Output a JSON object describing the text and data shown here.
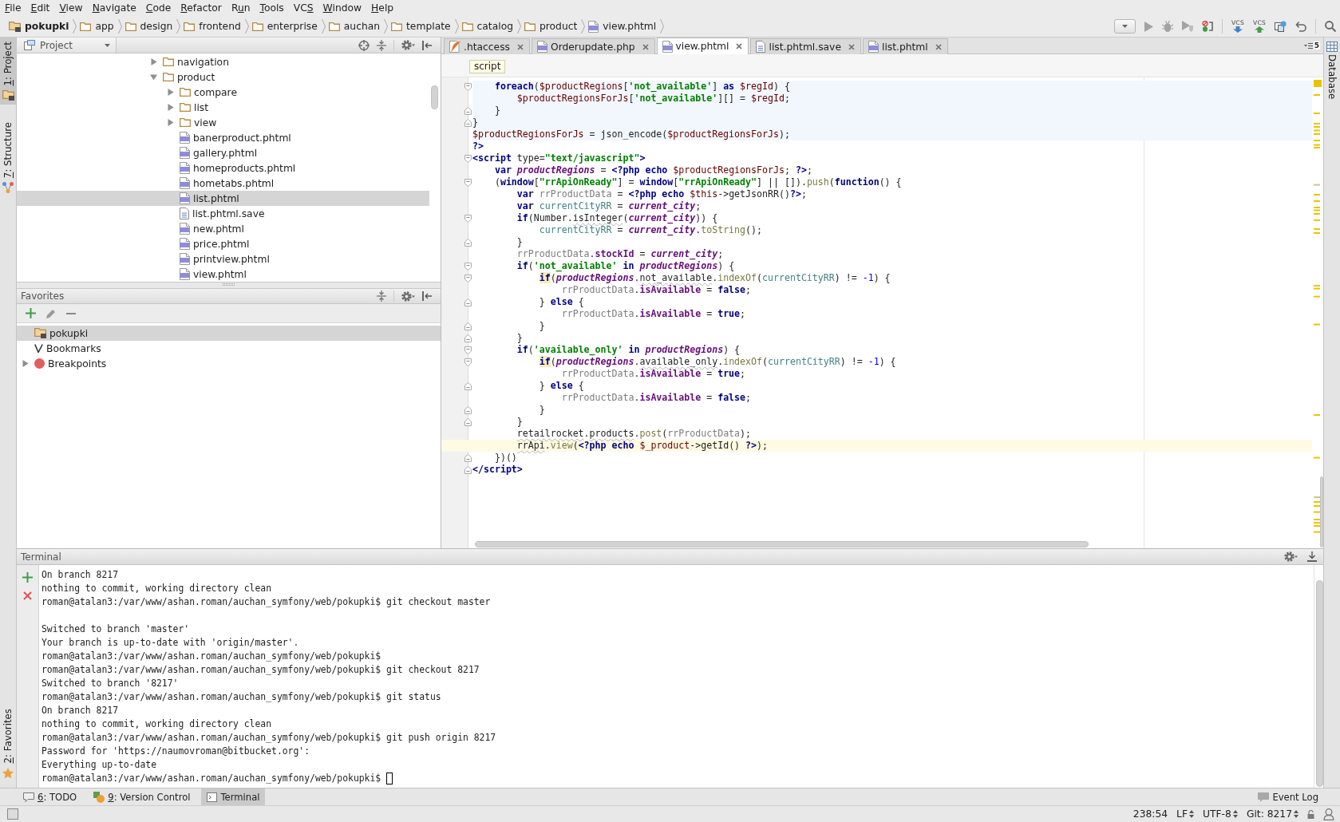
{
  "menu_bar": [
    {
      "label_parts": [
        {
          "text": "F",
          "underline": true
        },
        {
          "text": "ile",
          "underline": false
        }
      ]
    },
    {
      "label_parts": [
        {
          "text": "E",
          "underline": true
        },
        {
          "text": "dit",
          "underline": false
        }
      ]
    },
    {
      "label_parts": [
        {
          "text": "V",
          "underline": true
        },
        {
          "text": "iew",
          "underline": false
        }
      ]
    },
    {
      "label_parts": [
        {
          "text": "N",
          "underline": true
        },
        {
          "text": "avigate",
          "underline": false
        }
      ]
    },
    {
      "label_parts": [
        {
          "text": "C",
          "underline": true
        },
        {
          "text": "ode",
          "underline": false
        }
      ]
    },
    {
      "label_parts": [
        {
          "text": "R",
          "underline": true
        },
        {
          "text": "efactor",
          "underline": false
        }
      ]
    },
    {
      "label_parts": [
        {
          "text": "R",
          "underline": false
        },
        {
          "text": "u",
          "underline": true
        },
        {
          "text": "n",
          "underline": false
        }
      ]
    },
    {
      "label_parts": [
        {
          "text": "T",
          "underline": true
        },
        {
          "text": "ools",
          "underline": false
        }
      ]
    },
    {
      "label_parts": [
        {
          "text": "VC",
          "underline": false
        },
        {
          "text": "S",
          "underline": true
        }
      ]
    },
    {
      "label_parts": [
        {
          "text": "W",
          "underline": true
        },
        {
          "text": "indow",
          "underline": false
        }
      ]
    },
    {
      "label_parts": [
        {
          "text": "H",
          "underline": true
        },
        {
          "text": "elp",
          "underline": false
        }
      ]
    }
  ],
  "navigation_bar": {
    "breadcrumbs": [
      {
        "label": "pokupki",
        "kind": "project"
      },
      {
        "label": "app",
        "kind": "folder"
      },
      {
        "label": "design",
        "kind": "folder"
      },
      {
        "label": "frontend",
        "kind": "folder"
      },
      {
        "label": "enterprise",
        "kind": "folder"
      },
      {
        "label": "auchan",
        "kind": "folder"
      },
      {
        "label": "template",
        "kind": "folder"
      },
      {
        "label": "catalog",
        "kind": "folder"
      },
      {
        "label": "product",
        "kind": "folder"
      },
      {
        "label": "view.phtml",
        "kind": "php-file"
      }
    ],
    "vcs_buttons": [
      {
        "label": "VCS",
        "kind": "update"
      },
      {
        "label": "VCS",
        "kind": "commit"
      }
    ]
  },
  "left_tool_stripe": {
    "top": [
      {
        "label_parts": [
          {
            "text": "1",
            "underline": true
          },
          {
            "text": ": Project",
            "underline": false
          }
        ],
        "kind": "project",
        "selected": true
      },
      {
        "label_parts": [
          {
            "text": "7",
            "underline": true
          },
          {
            "text": ": Structure",
            "underline": false
          }
        ],
        "kind": "structure",
        "selected": false
      }
    ],
    "bottom": [
      {
        "label_parts": [
          {
            "text": "2",
            "underline": true
          },
          {
            "text": ": Favorites",
            "underline": false
          }
        ],
        "kind": "favorites",
        "selected": false
      }
    ]
  },
  "project_panel": {
    "view": "Project",
    "tree": [
      {
        "label": "navigation",
        "kind": "folder",
        "expanded": false,
        "selected": false
      },
      {
        "label": "product",
        "kind": "folder",
        "expanded": true,
        "selected": false,
        "children": [
          {
            "label": "compare",
            "kind": "folder",
            "expanded": false,
            "selected": false
          },
          {
            "label": "list",
            "kind": "folder",
            "expanded": false,
            "selected": false
          },
          {
            "label": "view",
            "kind": "folder",
            "expanded": false,
            "selected": false
          },
          {
            "label": "banerproduct.phtml",
            "kind": "php-file",
            "selected": false
          },
          {
            "label": "gallery.phtml",
            "kind": "php-file",
            "selected": false
          },
          {
            "label": "homeproducts.phtml",
            "kind": "php-file",
            "selected": false
          },
          {
            "label": "hometabs.phtml",
            "kind": "php-file",
            "selected": false
          },
          {
            "label": "list.phtml",
            "kind": "php-file",
            "selected": true
          },
          {
            "label": "list.phtml.save",
            "kind": "text-file",
            "selected": false
          },
          {
            "label": "new.phtml",
            "kind": "php-file",
            "selected": false
          },
          {
            "label": "price.phtml",
            "kind": "php-file",
            "selected": false
          },
          {
            "label": "printview.phtml",
            "kind": "php-file",
            "selected": false
          },
          {
            "label": "view.phtml",
            "kind": "php-file",
            "selected": false
          }
        ]
      }
    ]
  },
  "favorites_panel": {
    "title": "Favorites",
    "items": [
      {
        "label": "pokupki",
        "kind": "project",
        "selected": true
      },
      {
        "label": "Bookmarks",
        "kind": "bookmarks",
        "selected": false
      },
      {
        "label": "Breakpoints",
        "kind": "breakpoints",
        "expanded": false,
        "selected": false
      }
    ]
  },
  "editor": {
    "tabs": [
      {
        "label": ".htaccess",
        "kind": "htaccess",
        "selected": false
      },
      {
        "label": "Orderupdate.php",
        "kind": "php-file",
        "selected": false
      },
      {
        "label": "view.phtml",
        "kind": "php-file",
        "selected": true
      },
      {
        "label": "list.phtml.save",
        "kind": "text-file",
        "selected": false
      },
      {
        "label": "list.phtml",
        "kind": "php-file",
        "selected": false
      }
    ],
    "hidden_tab_count": "5",
    "breadcrumb": "script",
    "lines": [
      {
        "kind": "php-block",
        "current": false,
        "fold_start": true,
        "fold_end": false,
        "tokens": [
          {
            "text": "    foreach",
            "kind": "keyword"
          },
          {
            "text": "(",
            "kind": "plain"
          },
          {
            "text": "$productRegions",
            "kind": "php-variable"
          },
          {
            "text": "[",
            "kind": "plain"
          },
          {
            "text": "'not_available'",
            "kind": "string"
          },
          {
            "text": "] ",
            "kind": "plain"
          },
          {
            "text": "as ",
            "kind": "keyword"
          },
          {
            "text": "$regId",
            "kind": "php-variable"
          },
          {
            "text": ") {",
            "kind": "plain"
          }
        ]
      },
      {
        "kind": "php-block",
        "current": false,
        "fold_start": false,
        "fold_end": false,
        "tokens": [
          {
            "text": "        $productRegionsForJs",
            "kind": "php-variable"
          },
          {
            "text": "[",
            "kind": "plain"
          },
          {
            "text": "'not_available'",
            "kind": "string"
          },
          {
            "text": "][] = ",
            "kind": "plain"
          },
          {
            "text": "$regId",
            "kind": "php-variable"
          },
          {
            "text": ";",
            "kind": "plain"
          }
        ]
      },
      {
        "kind": "php-block",
        "current": false,
        "fold_start": false,
        "fold_end": true,
        "tokens": [
          {
            "text": "    }",
            "kind": "plain"
          }
        ]
      },
      {
        "kind": "php-block",
        "current": false,
        "fold_start": false,
        "fold_end": true,
        "tokens": [
          {
            "text": "}",
            "kind": "plain"
          }
        ]
      },
      {
        "kind": "php-block",
        "current": false,
        "fold_start": false,
        "fold_end": false,
        "tokens": [
          {
            "text": "$productRegionsForJs",
            "kind": "php-variable"
          },
          {
            "text": " = json_encode(",
            "kind": "plain"
          },
          {
            "text": "$productRegionsForJs",
            "kind": "php-variable"
          },
          {
            "text": ");",
            "kind": "plain"
          }
        ]
      },
      {
        "kind": "template",
        "current": false,
        "fold_start": false,
        "fold_end": false,
        "tokens": [
          {
            "text": "?>",
            "kind": "php-tag"
          }
        ]
      },
      {
        "kind": "template",
        "current": false,
        "fold_start": true,
        "fold_end": false,
        "tokens": [
          {
            "text": "<script",
            "kind": "html-tag"
          },
          {
            "text": " type=",
            "kind": "plain"
          },
          {
            "text": "\"text/javascript\"",
            "kind": "string"
          },
          {
            "text": ">",
            "kind": "html-tag"
          }
        ]
      },
      {
        "kind": "template",
        "current": false,
        "fold_start": false,
        "fold_end": false,
        "tokens": [
          {
            "text": "    var ",
            "kind": "keyword"
          },
          {
            "text": "productRegions",
            "kind": "global-variable"
          },
          {
            "text": " = ",
            "kind": "plain"
          },
          {
            "text": "<?php ",
            "kind": "php-tag"
          },
          {
            "text": "echo ",
            "kind": "keyword"
          },
          {
            "text": "$productRegionsForJs",
            "kind": "php-variable"
          },
          {
            "text": "; ",
            "kind": "plain"
          },
          {
            "text": "?>",
            "kind": "php-tag"
          },
          {
            "text": ";",
            "kind": "plain"
          }
        ]
      },
      {
        "kind": "template",
        "current": false,
        "fold_start": true,
        "fold_end": false,
        "tokens": [
          {
            "text": "    (",
            "kind": "plain"
          },
          {
            "text": "window",
            "kind": "keyword"
          },
          {
            "text": "[",
            "kind": "plain"
          },
          {
            "text": "\"rrApiOnReady\"",
            "kind": "string"
          },
          {
            "text": "] = ",
            "kind": "plain"
          },
          {
            "text": "window",
            "kind": "keyword"
          },
          {
            "text": "[",
            "kind": "plain"
          },
          {
            "text": "\"rrApiOnReady\"",
            "kind": "string"
          },
          {
            "text": "] || []).",
            "kind": "plain"
          },
          {
            "text": "push",
            "kind": "method"
          },
          {
            "text": "(",
            "kind": "plain"
          },
          {
            "text": "function",
            "kind": "keyword"
          },
          {
            "text": "() {",
            "kind": "plain"
          }
        ]
      },
      {
        "kind": "template",
        "current": false,
        "fold_start": false,
        "fold_end": false,
        "tokens": [
          {
            "text": "        var ",
            "kind": "keyword"
          },
          {
            "text": "rrProductData",
            "kind": "implicit-variable"
          },
          {
            "text": " = ",
            "kind": "plain"
          },
          {
            "text": "<?php ",
            "kind": "php-tag"
          },
          {
            "text": "echo ",
            "kind": "keyword"
          },
          {
            "text": "$this",
            "kind": "php-variable"
          },
          {
            "text": "->getJsonRR()",
            "kind": "plain"
          },
          {
            "text": "?>",
            "kind": "php-tag"
          },
          {
            "text": ";",
            "kind": "plain"
          }
        ]
      },
      {
        "kind": "template",
        "current": false,
        "fold_start": false,
        "fold_end": false,
        "tokens": [
          {
            "text": "        var ",
            "kind": "keyword"
          },
          {
            "text": "currentCityRR",
            "kind": "local-variable"
          },
          {
            "text": " = ",
            "kind": "plain"
          },
          {
            "text": "current_city",
            "kind": "global-variable"
          },
          {
            "text": ";",
            "kind": "plain"
          }
        ]
      },
      {
        "kind": "template",
        "current": false,
        "fold_start": true,
        "fold_end": false,
        "tokens": [
          {
            "text": "        if",
            "kind": "keyword"
          },
          {
            "text": "(Number.",
            "kind": "plain"
          },
          {
            "text": "isInteger",
            "kind": "unresolved"
          },
          {
            "text": "(",
            "kind": "plain"
          },
          {
            "text": "current_city",
            "kind": "global-variable"
          },
          {
            "text": ")) {",
            "kind": "plain"
          }
        ]
      },
      {
        "kind": "template",
        "current": false,
        "fold_start": false,
        "fold_end": false,
        "tokens": [
          {
            "text": "            currentCityRR",
            "kind": "local-variable"
          },
          {
            "text": " = ",
            "kind": "plain"
          },
          {
            "text": "current_city",
            "kind": "global-variable"
          },
          {
            "text": ".",
            "kind": "plain"
          },
          {
            "text": "toString",
            "kind": "method"
          },
          {
            "text": "();",
            "kind": "plain"
          }
        ]
      },
      {
        "kind": "template",
        "current": false,
        "fold_start": false,
        "fold_end": true,
        "tokens": [
          {
            "text": "        }",
            "kind": "plain"
          }
        ]
      },
      {
        "kind": "template",
        "current": false,
        "fold_start": false,
        "fold_end": false,
        "tokens": [
          {
            "text": "        rrProductData",
            "kind": "implicit-variable"
          },
          {
            "text": ".",
            "kind": "plain"
          },
          {
            "text": "stockId",
            "kind": "field"
          },
          {
            "text": " = ",
            "kind": "plain"
          },
          {
            "text": "current_city",
            "kind": "global-variable"
          },
          {
            "text": ";",
            "kind": "plain"
          }
        ]
      },
      {
        "kind": "template",
        "current": false,
        "fold_start": true,
        "fold_end": false,
        "tokens": [
          {
            "text": "        if",
            "kind": "keyword"
          },
          {
            "text": "(",
            "kind": "plain"
          },
          {
            "text": "'not_available' ",
            "kind": "string"
          },
          {
            "text": "in ",
            "kind": "keyword"
          },
          {
            "text": "productRegions",
            "kind": "global-variable"
          },
          {
            "text": ") {",
            "kind": "plain"
          }
        ]
      },
      {
        "kind": "template",
        "current": false,
        "fold_start": true,
        "fold_end": false,
        "tokens": [
          {
            "text": "            if",
            "kind": "keyword-warning"
          },
          {
            "text": "(",
            "kind": "plain"
          },
          {
            "text": "productRegions",
            "kind": "global-variable"
          },
          {
            "text": ".",
            "kind": "plain"
          },
          {
            "text": "not_available",
            "kind": "unresolved"
          },
          {
            "text": ".",
            "kind": "plain"
          },
          {
            "text": "indexOf",
            "kind": "method"
          },
          {
            "text": "(",
            "kind": "plain"
          },
          {
            "text": "currentCityRR",
            "kind": "local-variable"
          },
          {
            "text": ") != ",
            "kind": "plain"
          },
          {
            "text": "-1",
            "kind": "number"
          },
          {
            "text": ") {",
            "kind": "plain"
          }
        ]
      },
      {
        "kind": "template",
        "current": false,
        "fold_start": false,
        "fold_end": false,
        "tokens": [
          {
            "text": "                rrProductData",
            "kind": "implicit-variable"
          },
          {
            "text": ".",
            "kind": "plain"
          },
          {
            "text": "isAvailable",
            "kind": "field"
          },
          {
            "text": " = ",
            "kind": "plain"
          },
          {
            "text": "false",
            "kind": "keyword"
          },
          {
            "text": ";",
            "kind": "plain"
          }
        ]
      },
      {
        "kind": "template",
        "current": false,
        "fold_start": false,
        "fold_end": true,
        "tokens": [
          {
            "text": "            } ",
            "kind": "plain"
          },
          {
            "text": "else",
            "kind": "keyword"
          },
          {
            "text": " {",
            "kind": "plain"
          }
        ]
      },
      {
        "kind": "template",
        "current": false,
        "fold_start": false,
        "fold_end": false,
        "tokens": [
          {
            "text": "                rrProductData",
            "kind": "implicit-variable"
          },
          {
            "text": ".",
            "kind": "plain"
          },
          {
            "text": "isAvailable",
            "kind": "field"
          },
          {
            "text": " = ",
            "kind": "plain"
          },
          {
            "text": "true",
            "kind": "keyword"
          },
          {
            "text": ";",
            "kind": "plain"
          }
        ]
      },
      {
        "kind": "template",
        "current": false,
        "fold_start": false,
        "fold_end": true,
        "tokens": [
          {
            "text": "            }",
            "kind": "plain"
          }
        ]
      },
      {
        "kind": "template",
        "current": false,
        "fold_start": false,
        "fold_end": true,
        "tokens": [
          {
            "text": "        }",
            "kind": "plain"
          }
        ]
      },
      {
        "kind": "template",
        "current": false,
        "fold_start": true,
        "fold_end": false,
        "tokens": [
          {
            "text": "        if",
            "kind": "keyword"
          },
          {
            "text": "(",
            "kind": "plain"
          },
          {
            "text": "'available_only' ",
            "kind": "string"
          },
          {
            "text": "in ",
            "kind": "keyword"
          },
          {
            "text": "productRegions",
            "kind": "global-variable"
          },
          {
            "text": ") {",
            "kind": "plain"
          }
        ]
      },
      {
        "kind": "template",
        "current": false,
        "fold_start": true,
        "fold_end": false,
        "tokens": [
          {
            "text": "            if",
            "kind": "keyword-warning"
          },
          {
            "text": "(",
            "kind": "plain"
          },
          {
            "text": "productRegions",
            "kind": "global-variable"
          },
          {
            "text": ".",
            "kind": "plain"
          },
          {
            "text": "available_only",
            "kind": "unresolved"
          },
          {
            "text": ".",
            "kind": "plain"
          },
          {
            "text": "indexOf",
            "kind": "method"
          },
          {
            "text": "(",
            "kind": "plain"
          },
          {
            "text": "currentCityRR",
            "kind": "local-variable"
          },
          {
            "text": ") != ",
            "kind": "plain"
          },
          {
            "text": "-1",
            "kind": "number"
          },
          {
            "text": ") {",
            "kind": "plain"
          }
        ]
      },
      {
        "kind": "template",
        "current": false,
        "fold_start": false,
        "fold_end": false,
        "tokens": [
          {
            "text": "                rrProductData",
            "kind": "implicit-variable"
          },
          {
            "text": ".",
            "kind": "plain"
          },
          {
            "text": "isAvailable",
            "kind": "field"
          },
          {
            "text": " = ",
            "kind": "plain"
          },
          {
            "text": "true",
            "kind": "keyword"
          },
          {
            "text": ";",
            "kind": "plain"
          }
        ]
      },
      {
        "kind": "template",
        "current": false,
        "fold_start": false,
        "fold_end": true,
        "tokens": [
          {
            "text": "            } ",
            "kind": "plain"
          },
          {
            "text": "else",
            "kind": "keyword"
          },
          {
            "text": " {",
            "kind": "plain"
          }
        ]
      },
      {
        "kind": "template",
        "current": false,
        "fold_start": false,
        "fold_end": false,
        "tokens": [
          {
            "text": "                rrProductData",
            "kind": "implicit-variable"
          },
          {
            "text": ".",
            "kind": "plain"
          },
          {
            "text": "isAvailable",
            "kind": "field"
          },
          {
            "text": " = ",
            "kind": "plain"
          },
          {
            "text": "false",
            "kind": "keyword"
          },
          {
            "text": ";",
            "kind": "plain"
          }
        ]
      },
      {
        "kind": "template",
        "current": false,
        "fold_start": false,
        "fold_end": true,
        "tokens": [
          {
            "text": "            }",
            "kind": "plain"
          }
        ]
      },
      {
        "kind": "template",
        "current": false,
        "fold_start": false,
        "fold_end": true,
        "tokens": [
          {
            "text": "        }",
            "kind": "plain"
          }
        ]
      },
      {
        "kind": "template",
        "current": false,
        "fold_start": false,
        "fold_end": false,
        "tokens": [
          {
            "text": "        retailrocket",
            "kind": "unresolved"
          },
          {
            "text": ".",
            "kind": "plain"
          },
          {
            "text": "products",
            "kind": "unresolved"
          },
          {
            "text": ".",
            "kind": "plain"
          },
          {
            "text": "post",
            "kind": "method"
          },
          {
            "text": "(",
            "kind": "plain"
          },
          {
            "text": "rrProductData",
            "kind": "implicit-variable"
          },
          {
            "text": ");",
            "kind": "plain"
          }
        ]
      },
      {
        "kind": "template",
        "current": true,
        "fold_start": false,
        "fold_end": false,
        "tokens": [
          {
            "text": "        rrApi",
            "kind": "unresolved"
          },
          {
            "text": ".",
            "kind": "plain"
          },
          {
            "text": "view",
            "kind": "method"
          },
          {
            "text": "(",
            "kind": "plain"
          },
          {
            "text": "<?php ",
            "kind": "php-tag"
          },
          {
            "text": "echo ",
            "kind": "keyword"
          },
          {
            "text": "$_product",
            "kind": "php-variable"
          },
          {
            "text": "->getId() ",
            "kind": "plain"
          },
          {
            "text": "?>",
            "kind": "php-tag"
          },
          {
            "text": ");",
            "kind": "plain"
          }
        ]
      },
      {
        "kind": "template",
        "current": false,
        "fold_start": false,
        "fold_end": true,
        "tokens": [
          {
            "text": "    })()",
            "kind": "plain"
          }
        ]
      },
      {
        "kind": "template",
        "current": false,
        "fold_start": false,
        "fold_end": true,
        "tokens": [
          {
            "text": "</script>",
            "kind": "html-tag"
          }
        ]
      }
    ]
  },
  "right_tool_stripe": {
    "top": [
      {
        "label_parts": [
          {
            "text": "Database",
            "underline": false
          }
        ],
        "kind": "database",
        "selected": false
      }
    ]
  },
  "terminal": {
    "title": "Terminal",
    "output_blocks": [
      {
        "lines": [
          "On branch 8217",
          "nothing to commit, working directory clean",
          "roman@atalan3:/var/www/ashan.roman/auchan_symfony/web/pokupki$ git checkout master"
        ]
      },
      {
        "lines": [
          "Switched to branch 'master'",
          "Your branch is up-to-date with 'origin/master'.",
          "roman@atalan3:/var/www/ashan.roman/auchan_symfony/web/pokupki$",
          "roman@atalan3:/var/www/ashan.roman/auchan_symfony/web/pokupki$ git checkout 8217",
          "Switched to branch '8217'",
          "roman@atalan3:/var/www/ashan.roman/auchan_symfony/web/pokupki$ git status",
          "On branch 8217",
          "nothing to commit, working directory clean",
          "roman@atalan3:/var/www/ashan.roman/auchan_symfony/web/pokupki$ git push origin 8217",
          "Password for 'https://naumovroman@bitbucket.org':",
          "Everything up-to-date",
          "roman@atalan3:/var/www/ashan.roman/auchan_symfony/web/pokupki$"
        ]
      }
    ],
    "cursor": true
  },
  "tool_window_bar": {
    "left": [
      {
        "label_parts": [
          {
            "text": "6",
            "underline": true
          },
          {
            "text": ": TODO",
            "underline": false
          }
        ],
        "kind": "todo",
        "selected": false
      },
      {
        "label_parts": [
          {
            "text": "9",
            "underline": true
          },
          {
            "text": ": Version Control",
            "underline": false
          }
        ],
        "kind": "version-control",
        "selected": false
      },
      {
        "label_parts": [
          {
            "text": "Terminal",
            "underline": false
          }
        ],
        "kind": "terminal",
        "selected": true
      }
    ],
    "right": [
      {
        "label_parts": [
          {
            "text": "Event Log",
            "underline": false
          }
        ],
        "kind": "event-log",
        "selected": false
      }
    ]
  },
  "status_bar": {
    "caret_position": "238:54",
    "line_separator": "LF",
    "encoding": "UTF-8",
    "vcs_branch": "Git: 8217"
  }
}
